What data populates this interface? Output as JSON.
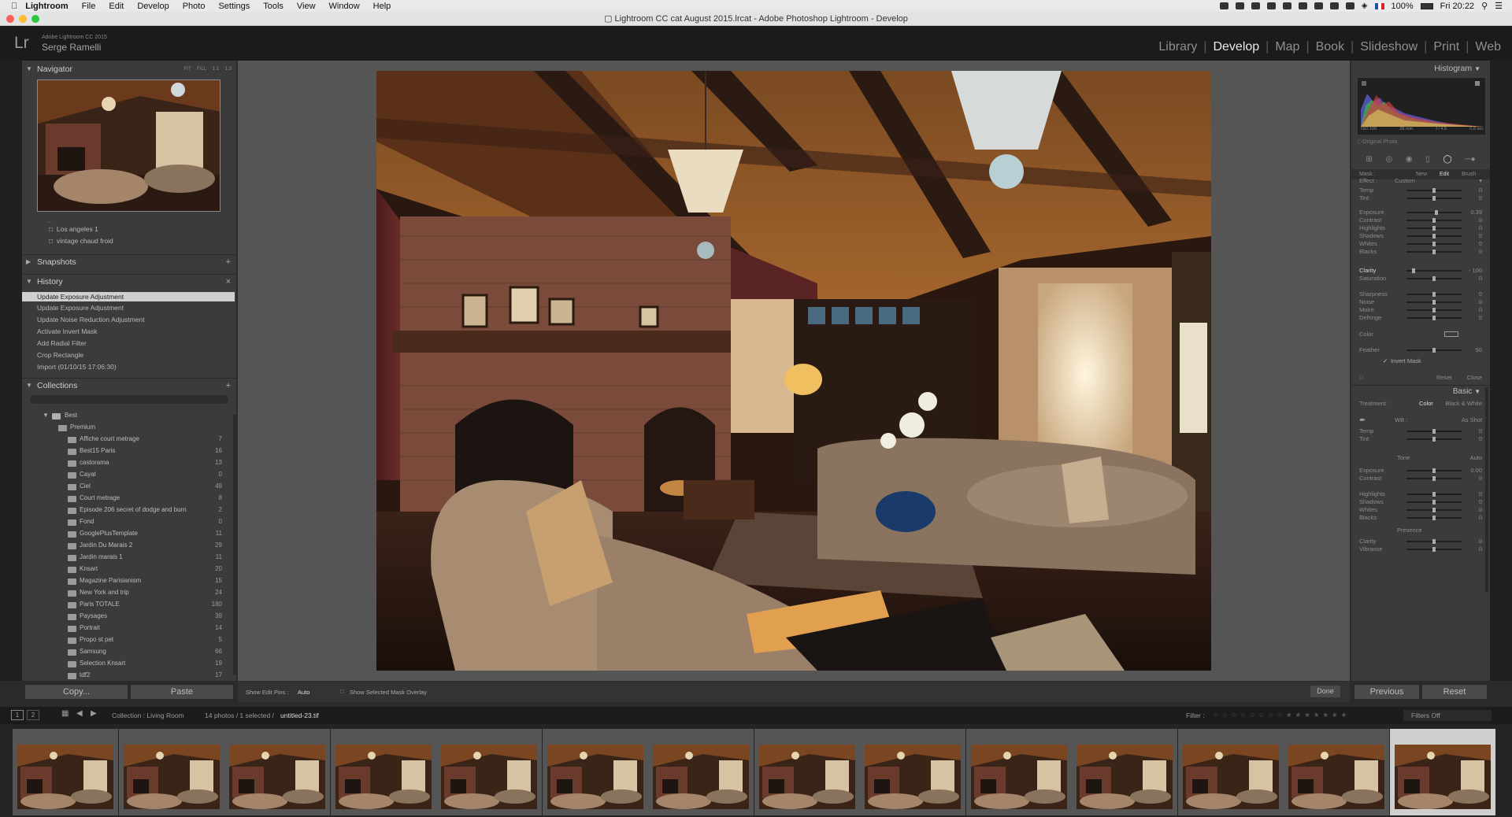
{
  "menubar": {
    "app": "Lightroom",
    "items": [
      "File",
      "Edit",
      "Develop",
      "Photo",
      "Settings",
      "Tools",
      "View",
      "Window",
      "Help"
    ],
    "battery": "100%",
    "clock": "Fri 20:22"
  },
  "window": {
    "title": "Lightroom CC cat August 2015.lrcat - Adobe Photoshop Lightroom - Develop"
  },
  "identity": {
    "logo": "Lr",
    "version": "Adobe Lightroom CC 2015",
    "user": "Serge Ramelli"
  },
  "modules": [
    "Library",
    "Develop",
    "Map",
    "Book",
    "Slideshow",
    "Print",
    "Web"
  ],
  "active_module": "Develop",
  "left": {
    "navigator": {
      "label": "Navigator",
      "zoom": [
        "FIT",
        "FILL",
        "1:1",
        "1:3"
      ]
    },
    "presets": [
      "Los angeles 1",
      "vintage chaud froid"
    ],
    "snapshots": {
      "label": "Snapshots"
    },
    "history": {
      "label": "History",
      "items": [
        "Update Exposure Adjustment",
        "Update Exposure Adjustment",
        "Update Noise Reduction Adjustment",
        "Activate Invert Mask",
        "Add Radial Filter",
        "Crop Rectangle",
        "Import (01/10/15 17:06:30)"
      ]
    },
    "collections": {
      "label": "Collections",
      "root": "Best",
      "items": [
        {
          "name": "Premium",
          "count": ""
        },
        {
          "name": "Affiche court metrage",
          "count": "7"
        },
        {
          "name": "Best15 Paris",
          "count": "16"
        },
        {
          "name": "castorama",
          "count": "13"
        },
        {
          "name": "Cayat",
          "count": "0"
        },
        {
          "name": "Ciel",
          "count": "49"
        },
        {
          "name": "Court metrage",
          "count": "8"
        },
        {
          "name": "Episode 206 secret of dodge and burn",
          "count": "2"
        },
        {
          "name": "Fond",
          "count": "0"
        },
        {
          "name": "GooglePlusTemplate",
          "count": "11"
        },
        {
          "name": "Jardin Du Marais 2",
          "count": "29"
        },
        {
          "name": "Jardin marais 1",
          "count": "11"
        },
        {
          "name": "Knsart",
          "count": "20"
        },
        {
          "name": "Magazine Parisianism",
          "count": "15"
        },
        {
          "name": "New York and trip",
          "count": "24"
        },
        {
          "name": "Paris TOTALE",
          "count": "180"
        },
        {
          "name": "Paysages",
          "count": "39"
        },
        {
          "name": "Portrait",
          "count": "14"
        },
        {
          "name": "Propo st pet",
          "count": "5"
        },
        {
          "name": "Samsung",
          "count": "66"
        },
        {
          "name": "Selection Knsart",
          "count": "19"
        },
        {
          "name": "tdf2",
          "count": "17"
        }
      ]
    },
    "copy_btn": "Copy...",
    "paste_btn": "Paste"
  },
  "center": {
    "show_edit_pins_label": "Show Edit Pins :",
    "show_edit_pins_value": "Auto",
    "show_overlay_label": "Show Selected Mask Overlay",
    "done_btn": "Done"
  },
  "right": {
    "histogram": {
      "label": "Histogram",
      "iso": "ISO 100",
      "focal": "28 mm",
      "aperture": "f / 4.5",
      "shutter": "0.8 sec",
      "original": "Original Photo"
    },
    "mask": {
      "label": "Mask :",
      "new": "New",
      "edit": "Edit",
      "brush": "Brush"
    },
    "effect": {
      "label": "Effect :",
      "value": "Custom"
    },
    "sliders": [
      {
        "label": "Temp",
        "value": "0",
        "pos": 0.5
      },
      {
        "label": "Tint",
        "value": "0",
        "pos": 0.5
      },
      {
        "label": "Exposure",
        "value": "0.39",
        "pos": 0.55
      },
      {
        "label": "Contrast",
        "value": "0",
        "pos": 0.5
      },
      {
        "label": "Highlights",
        "value": "0",
        "pos": 0.5
      },
      {
        "label": "Shadows",
        "value": "0",
        "pos": 0.5
      },
      {
        "label": "Whites",
        "value": "0",
        "pos": 0.5
      },
      {
        "label": "Blacks",
        "value": "0",
        "pos": 0.5
      },
      {
        "label": "Clarity",
        "value": "- 100",
        "pos": 0.1
      },
      {
        "label": "Saturation",
        "value": "0",
        "pos": 0.5
      },
      {
        "label": "Sharpness",
        "value": "0",
        "pos": 0.5
      },
      {
        "label": "Noise",
        "value": "0",
        "pos": 0.5
      },
      {
        "label": "Moire",
        "value": "0",
        "pos": 0.5
      },
      {
        "label": "Defringe",
        "value": "0",
        "pos": 0.5
      }
    ],
    "color_label": "Color",
    "feather": {
      "label": "Feather",
      "value": "50"
    },
    "invert_mask": "Invert Mask",
    "reset": "Reset",
    "close": "Close",
    "basic": {
      "label": "Basic",
      "treatment": "Treatment :",
      "color": "Color",
      "bw": "Black & White",
      "wb": "WB :",
      "wb_value": "As Shot",
      "tone": "Tone",
      "auto": "Auto",
      "presence": "Presence",
      "sliders": [
        {
          "label": "Temp",
          "value": "0"
        },
        {
          "label": "Tint",
          "value": "0"
        },
        {
          "label": "Exposure",
          "value": "0.00"
        },
        {
          "label": "Contrast",
          "value": "0"
        },
        {
          "label": "Highlights",
          "value": "0"
        },
        {
          "label": "Shadows",
          "value": "0"
        },
        {
          "label": "Whites",
          "value": "0"
        },
        {
          "label": "Blacks",
          "value": "0"
        },
        {
          "label": "Clarity",
          "value": "0"
        },
        {
          "label": "Vibrance",
          "value": "0"
        }
      ]
    },
    "previous_btn": "Previous",
    "reset_btn": "Reset"
  },
  "filmbar": {
    "source": "Collection : Living Room",
    "count": "14 photos / 1 selected /",
    "file": "untitled-23.tif",
    "filter_label": "Filter :",
    "filters_off": "Filters Off"
  },
  "filmstrip_count": 14
}
